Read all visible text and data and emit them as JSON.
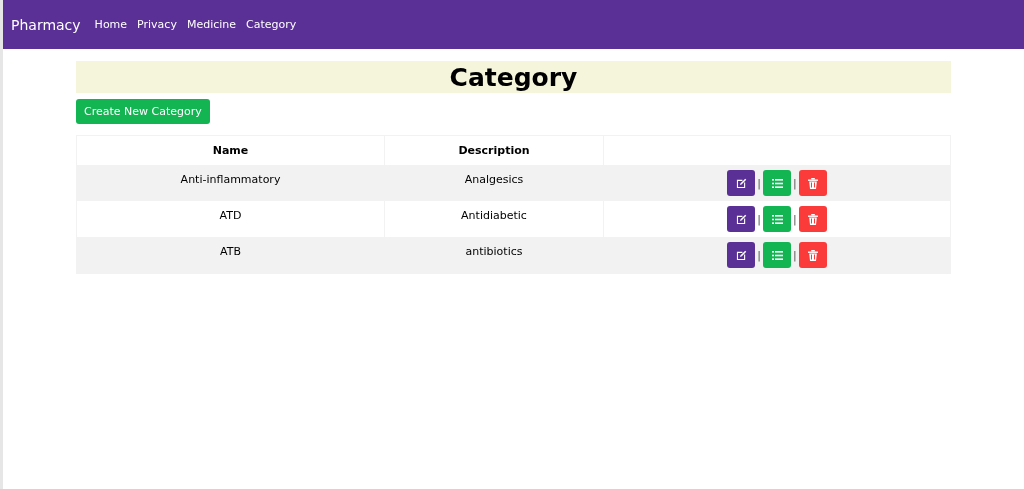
{
  "navbar": {
    "brand": "Pharmacy",
    "links": [
      "Home",
      "Privacy",
      "Medicine",
      "Category"
    ]
  },
  "heading": "Category",
  "create_button": "Create New Category",
  "table": {
    "columns": [
      "Name",
      "Description"
    ],
    "rows": [
      {
        "name": "Anti-inflammatory",
        "description": "Analgesics",
        "separators": [
          "|",
          "|"
        ]
      },
      {
        "name": "ATD",
        "description": "Antidiabetic",
        "separators": [
          "|",
          "|"
        ]
      },
      {
        "name": "ATB",
        "description": "antibiotics",
        "separators": [
          "|",
          "|"
        ]
      }
    ]
  }
}
